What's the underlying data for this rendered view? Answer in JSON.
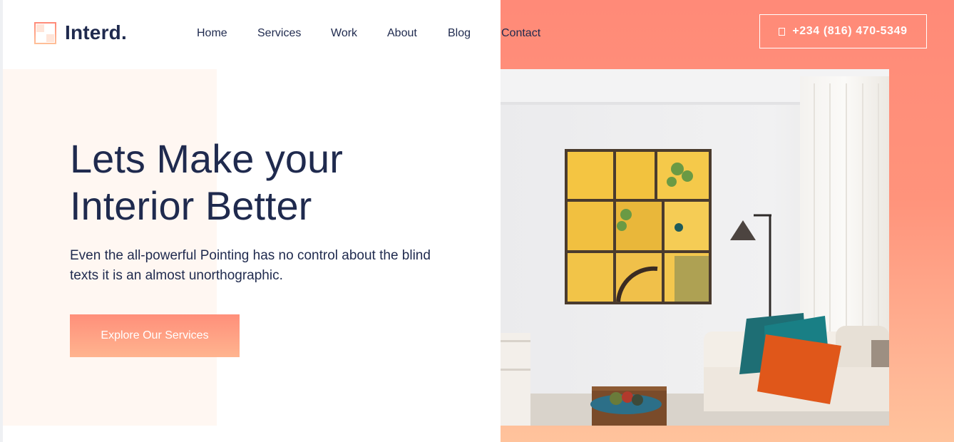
{
  "brand": {
    "name": "Interd.",
    "accent": "#ff8a78",
    "navy": "#1f2a4e"
  },
  "nav": {
    "items": [
      {
        "label": "Home"
      },
      {
        "label": "Services"
      },
      {
        "label": "Work"
      },
      {
        "label": "About"
      },
      {
        "label": "Blog"
      },
      {
        "label": "Contact"
      }
    ]
  },
  "header": {
    "phone_icon": "phone-icon",
    "phone_label": "+234 (816) 470-5349"
  },
  "hero": {
    "title_line1": "Lets Make your",
    "title_line2": "Interior Better",
    "subtitle": "Even the all-powerful Pointing has no control about the blind texts it is an almost unorthographic.",
    "cta_label": "Explore Our Services"
  }
}
